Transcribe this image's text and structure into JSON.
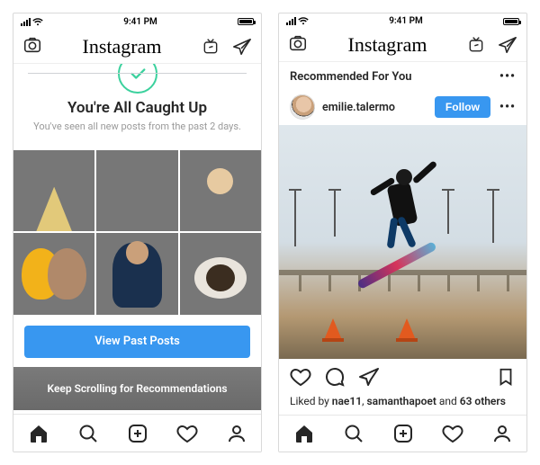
{
  "statusbar": {
    "time": "9:41 PM"
  },
  "header": {
    "logo": "Instagram"
  },
  "caughtup": {
    "title": "You're All Caught Up",
    "subtitle": "You've seen all new posts from the past 2 days.",
    "button": "View Past Posts",
    "scroll_hint": "Keep Scrolling for Recommendations"
  },
  "recommended": {
    "title": "Recommended For You",
    "post": {
      "username": "emilie.talermo",
      "follow_label": "Follow",
      "likes_prefix": "Liked by ",
      "liker1": "nae11",
      "likes_sep": ", ",
      "liker2": "samanthapoet",
      "likes_and": " and ",
      "others_count": "63 others"
    }
  }
}
